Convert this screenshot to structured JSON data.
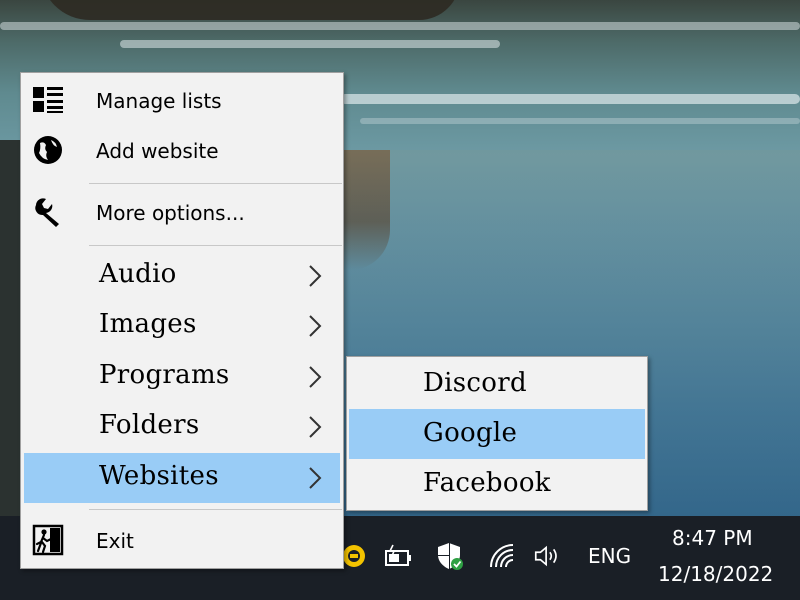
{
  "menu": {
    "items": [
      {
        "label": "Manage lists",
        "icon": "list-icon"
      },
      {
        "label": "Add website",
        "icon": "globe-icon"
      },
      {
        "label": "More options...",
        "icon": "wrench-icon"
      },
      {
        "label": "Audio",
        "icon": "chevron-right-icon",
        "has_submenu": true
      },
      {
        "label": "Images",
        "icon": "chevron-right-icon",
        "has_submenu": true
      },
      {
        "label": "Programs",
        "icon": "chevron-right-icon",
        "has_submenu": true
      },
      {
        "label": "Folders",
        "icon": "chevron-right-icon",
        "has_submenu": true
      },
      {
        "label": "Websites",
        "icon": "chevron-right-icon",
        "has_submenu": true,
        "highlighted": true
      },
      {
        "label": "Exit",
        "icon": "exit-icon"
      }
    ],
    "highlight_color": "#99ccf6"
  },
  "submenu": {
    "items": [
      {
        "label": "Discord"
      },
      {
        "label": "Google",
        "highlighted": true
      },
      {
        "label": "Facebook"
      }
    ]
  },
  "taskbar": {
    "language": "ENG",
    "time": "8:47 PM",
    "date": "12/18/2022",
    "tray_icons": [
      "app-tray-icon",
      "battery-icon",
      "security-shield-icon",
      "wifi-icon",
      "volume-icon"
    ],
    "background_color": "#1a1f26"
  }
}
